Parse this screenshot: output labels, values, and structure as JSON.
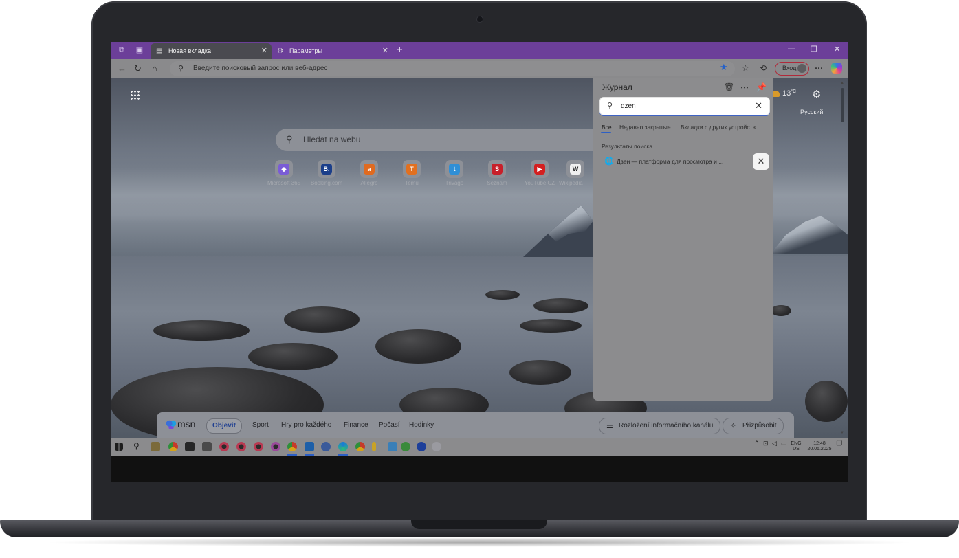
{
  "browser": {
    "tabs": [
      {
        "label": "Новая вкладка",
        "icon": "new-tab-page-icon",
        "active": true
      },
      {
        "label": "Параметры",
        "icon": "gear-icon",
        "active": false
      }
    ],
    "address_placeholder": "Введите поисковый запрос или веб-адрес",
    "profile_label": "Вход",
    "accent_color": "#6c3f99"
  },
  "newtab": {
    "search_placeholder": "Hledat na webu",
    "weather_temp": "13",
    "weather_unit": "°C",
    "language": "Русский",
    "quick_links": [
      {
        "label": "Microsoft 365",
        "icon": "microsoft-365-icon",
        "color": "#7a5cd6",
        "glyph": "◆"
      },
      {
        "label": "Booking.com",
        "icon": "booking-icon",
        "color": "#1c3f8a",
        "glyph": "B."
      },
      {
        "label": "Allegro",
        "icon": "allegro-icon",
        "color": "#e06a1f",
        "glyph": "a"
      },
      {
        "label": "Temu",
        "icon": "temu-icon",
        "color": "#e2701f",
        "glyph": "T"
      },
      {
        "label": "Trivago",
        "icon": "trivago-icon",
        "color": "#2f8fd6",
        "glyph": "t"
      },
      {
        "label": "Seznam",
        "icon": "seznam-icon",
        "color": "#c8202a",
        "glyph": "S"
      },
      {
        "label": "YouTube CZ",
        "icon": "youtube-icon",
        "color": "#d41f1f",
        "glyph": "▶"
      },
      {
        "label": "Wikipedia",
        "icon": "wikipedia-icon",
        "color": "#555555",
        "glyph": "W"
      }
    ]
  },
  "msn": {
    "logo": "msn",
    "tabs": [
      "Objevit",
      "Sport",
      "Hry pro každého",
      "Finance",
      "Počasí",
      "Hodinky"
    ],
    "layout_button": "Rozložení informačního kanálu",
    "customize_button": "Přizpůsobit"
  },
  "history": {
    "title": "Журнал",
    "search_value": "dzen",
    "tabs": [
      "Все",
      "Недавно закрытые",
      "Вкладки с других устройств"
    ],
    "section_title": "Результаты поиска",
    "results": [
      {
        "title": "Дзен — платформа для просмотра и ..."
      }
    ]
  },
  "taskbar": {
    "lang_line1": "ENG",
    "lang_line2": "US",
    "time": "12:48",
    "date": "20.05.2025"
  }
}
